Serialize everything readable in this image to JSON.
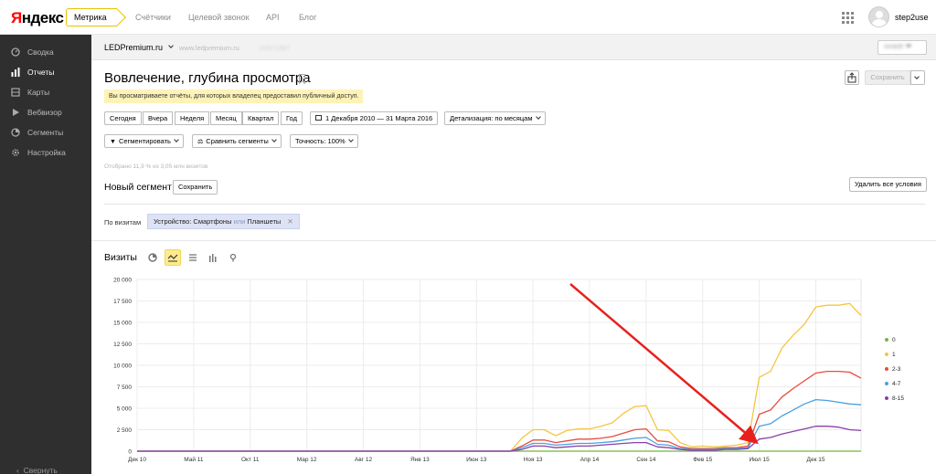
{
  "header": {
    "logo_first": "Я",
    "logo_rest": "ндекс",
    "product": "Метрика",
    "nav": [
      "Счётчики",
      "Целевой звонок",
      "API",
      "Блог"
    ],
    "username": "step2use"
  },
  "sidebar": {
    "items": [
      {
        "label": "Сводка",
        "icon": "dashboard-icon"
      },
      {
        "label": "Отчеты",
        "icon": "reports-icon"
      },
      {
        "label": "Карты",
        "icon": "maps-icon"
      },
      {
        "label": "Вебвизор",
        "icon": "play-icon"
      },
      {
        "label": "Сегменты",
        "icon": "segments-icon"
      },
      {
        "label": "Настройка",
        "icon": "gear-icon"
      }
    ],
    "active": "Отчеты",
    "collapse_label": "Свернуть"
  },
  "counter": {
    "name": "LEDPremium.ru",
    "url": "www.ledpremium.ru",
    "id": "22671397",
    "account": "rentelll"
  },
  "report": {
    "title": "Вовлечение, глубина просмотра",
    "notice": "Вы просматриваете отчёты, для которых владелец предоставил публичный доступ.",
    "save_label": "Сохранить"
  },
  "period": {
    "buttons": [
      "Сегодня",
      "Вчера",
      "Неделя",
      "Месяц",
      "Квартал",
      "Год"
    ],
    "range": "1 Декабря 2010 — 31 Марта 2016",
    "detail": "Детализация: по месяцам"
  },
  "tools": {
    "segment": "Сегментировать",
    "compare": "Сравнить сегменты",
    "accuracy": "Точность: 100%"
  },
  "segment": {
    "sampled": "Отобрано 11,9 % из 3,05 млн визитов",
    "title": "Новый сегмент",
    "save": "Сохранить",
    "delete_all": "Удалить все условия",
    "by_visits": "По визитам",
    "condition_prefix": "Устройство: Смартфоны",
    "condition_or": "или",
    "condition_suffix": "Планшеты",
    "remove": "✕"
  },
  "chart_section": {
    "label": "Визиты",
    "types": [
      "pie-chart-icon",
      "line-chart-icon",
      "area-chart-icon",
      "bar-chart-icon",
      "map-pin-icon"
    ],
    "active_type": "line-chart-icon"
  },
  "chart_data": {
    "type": "line",
    "title": "",
    "xlabel": "",
    "ylabel": "",
    "ylim": [
      0,
      20000
    ],
    "yticks": [
      "0",
      "2 500",
      "5 000",
      "7 500",
      "10 000",
      "12 500",
      "15 000",
      "17 500",
      "20 000"
    ],
    "x_tick_labels": [
      "Дек 10",
      "Май 11",
      "Окт 11",
      "Мар 12",
      "Авг 12",
      "Янв 13",
      "Июн 13",
      "Ноя 13",
      "Апр 14",
      "Сен 14",
      "Фев 15",
      "Июл 15",
      "Дек 15"
    ],
    "x_tick_month_index": [
      0,
      5,
      10,
      15,
      20,
      25,
      30,
      35,
      40,
      45,
      50,
      55,
      60
    ],
    "x_start": "Дек 10",
    "grid": true,
    "legend_position": "right",
    "annotation": "red arrow pointing to Jun–Jul 2015 jump",
    "series": [
      {
        "name": "0",
        "color": "#6cbb3c",
        "values": [
          0,
          0,
          0,
          0,
          0,
          0,
          0,
          0,
          0,
          0,
          0,
          0,
          0,
          0,
          0,
          0,
          0,
          0,
          0,
          0,
          0,
          0,
          0,
          0,
          0,
          0,
          0,
          0,
          0,
          0,
          0,
          0,
          0,
          0,
          0,
          0,
          0,
          0,
          0,
          0,
          0,
          0,
          0,
          0,
          0,
          0,
          0,
          0,
          0,
          0,
          0,
          0,
          0,
          0,
          0,
          0,
          0,
          0,
          0,
          0,
          0,
          0,
          0,
          0,
          0
        ]
      },
      {
        "name": "1",
        "color": "#f5c542",
        "values": [
          0,
          0,
          0,
          0,
          0,
          0,
          0,
          0,
          0,
          0,
          0,
          0,
          0,
          0,
          0,
          0,
          0,
          0,
          0,
          0,
          0,
          0,
          0,
          0,
          0,
          0,
          0,
          0,
          0,
          0,
          0,
          0,
          0,
          0,
          1500,
          2500,
          2500,
          1800,
          2400,
          2600,
          2600,
          2900,
          3300,
          4400,
          5200,
          5300,
          2500,
          2400,
          1000,
          500,
          600,
          500,
          600,
          700,
          1000,
          8600,
          9300,
          12000,
          13500,
          14800,
          16800,
          17000,
          17000,
          17200,
          15800
        ]
      },
      {
        "name": "2-3",
        "color": "#e84c3d",
        "values": [
          0,
          0,
          0,
          0,
          0,
          0,
          0,
          0,
          0,
          0,
          0,
          0,
          0,
          0,
          0,
          0,
          0,
          0,
          0,
          0,
          0,
          0,
          0,
          0,
          0,
          0,
          0,
          0,
          0,
          0,
          0,
          0,
          0,
          0,
          600,
          1300,
          1300,
          1000,
          1200,
          1400,
          1400,
          1500,
          1700,
          2100,
          2500,
          2600,
          1200,
          1100,
          500,
          300,
          300,
          300,
          400,
          400,
          600,
          4300,
          4800,
          6300,
          7300,
          8200,
          9100,
          9300,
          9300,
          9200,
          8500
        ]
      },
      {
        "name": "4-7",
        "color": "#4a9fe0",
        "values": [
          0,
          0,
          0,
          0,
          0,
          0,
          0,
          0,
          0,
          0,
          0,
          0,
          0,
          0,
          0,
          0,
          0,
          0,
          0,
          0,
          0,
          0,
          0,
          0,
          0,
          0,
          0,
          0,
          0,
          0,
          0,
          0,
          0,
          0,
          400,
          900,
          900,
          700,
          800,
          900,
          900,
          1000,
          1100,
          1300,
          1500,
          1600,
          800,
          700,
          300,
          200,
          200,
          200,
          300,
          300,
          400,
          2900,
          3200,
          4100,
          4800,
          5500,
          6000,
          5900,
          5700,
          5500,
          5400
        ]
      },
      {
        "name": "8-15",
        "color": "#8a3fa8",
        "values": [
          0,
          0,
          0,
          0,
          0,
          0,
          0,
          0,
          0,
          0,
          0,
          0,
          0,
          0,
          0,
          0,
          0,
          0,
          0,
          0,
          0,
          0,
          0,
          0,
          0,
          0,
          0,
          0,
          0,
          0,
          0,
          0,
          0,
          0,
          200,
          600,
          600,
          400,
          500,
          600,
          600,
          700,
          800,
          900,
          1000,
          1000,
          500,
          400,
          200,
          100,
          100,
          100,
          200,
          200,
          300,
          1400,
          1600,
          2000,
          2300,
          2600,
          2900,
          2900,
          2800,
          2500,
          2400
        ]
      }
    ]
  }
}
